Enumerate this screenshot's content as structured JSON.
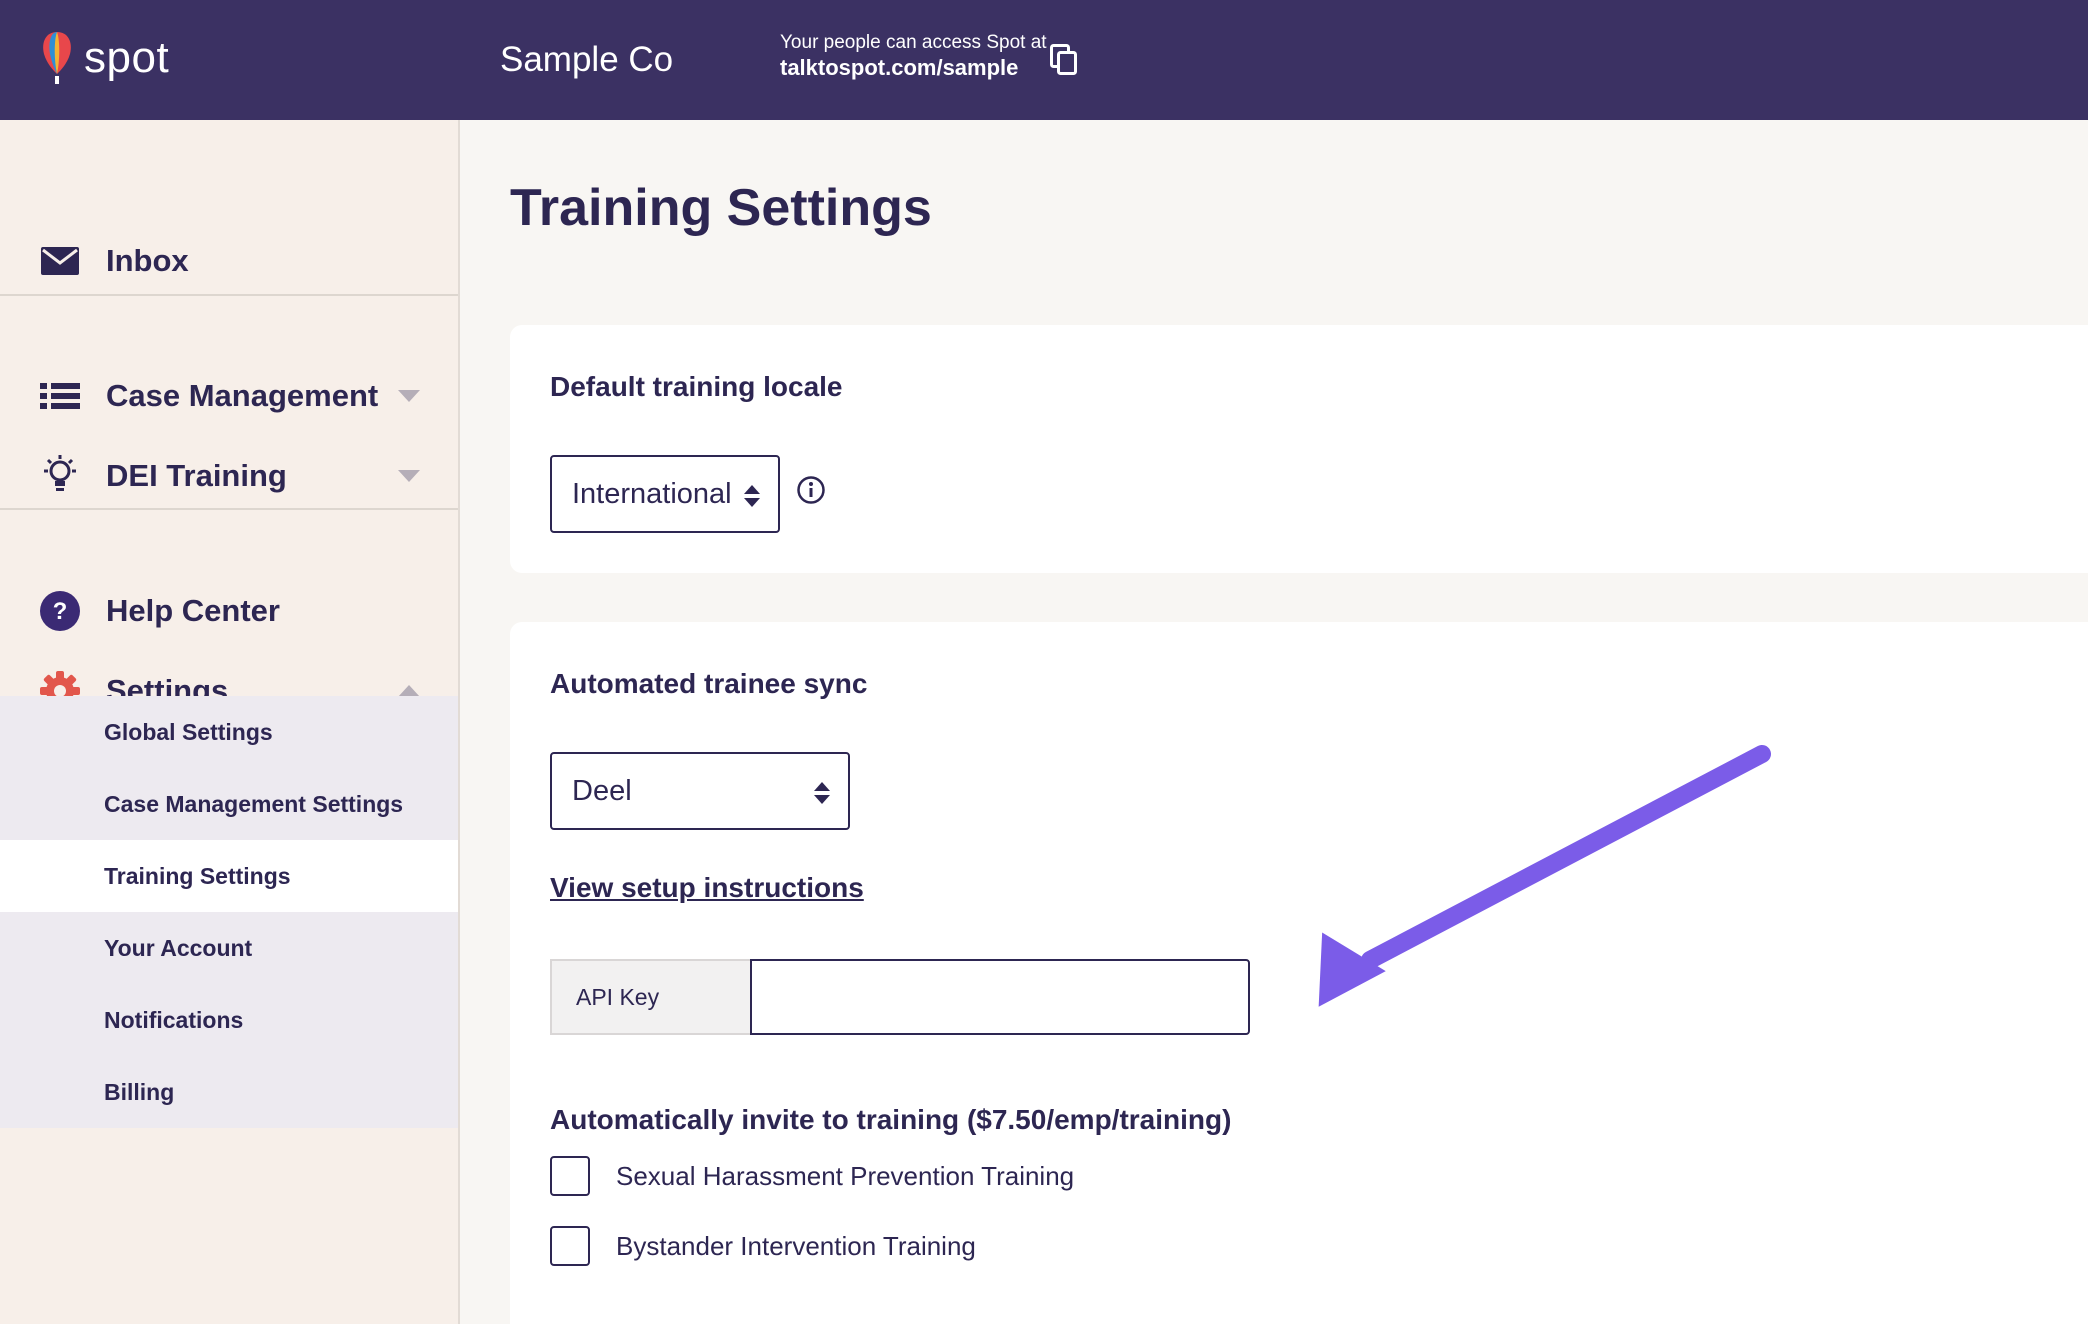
{
  "header": {
    "logo_text": "spot",
    "org_name": "Sample Co",
    "access_label": "Your people can access Spot at",
    "access_url": "talktospot.com/sample"
  },
  "sidebar": {
    "inbox": "Inbox",
    "case_management": "Case Management",
    "dei_training": "DEI Training",
    "help_center": "Help Center",
    "settings": "Settings",
    "sub_items": [
      "Global Settings",
      "Case Management Settings",
      "Training Settings",
      "Your Account",
      "Notifications",
      "Billing"
    ],
    "active_sub_item": "Training Settings"
  },
  "main": {
    "title": "Training Settings",
    "locale_card": {
      "heading": "Default training locale",
      "selected": "International"
    },
    "sync_card": {
      "heading": "Automated trainee sync",
      "provider_selected": "Deel",
      "setup_link": "View setup instructions",
      "api_key_label": "API Key",
      "api_key_value": "",
      "invite_heading": "Automatically invite to training ($7.50/emp/training)",
      "trainings": [
        {
          "label": "Sexual Harassment Prevention Training",
          "checked": false
        },
        {
          "label": "Bystander Intervention Training",
          "checked": false
        }
      ]
    }
  },
  "colors": {
    "header_bg": "#3b3163",
    "text_primary": "#2d2652",
    "sidebar_bg": "#f7efe9",
    "subnav_bg": "#edeaf0",
    "annotation_arrow": "#7b5ce8",
    "settings_icon": "#e2574c"
  }
}
